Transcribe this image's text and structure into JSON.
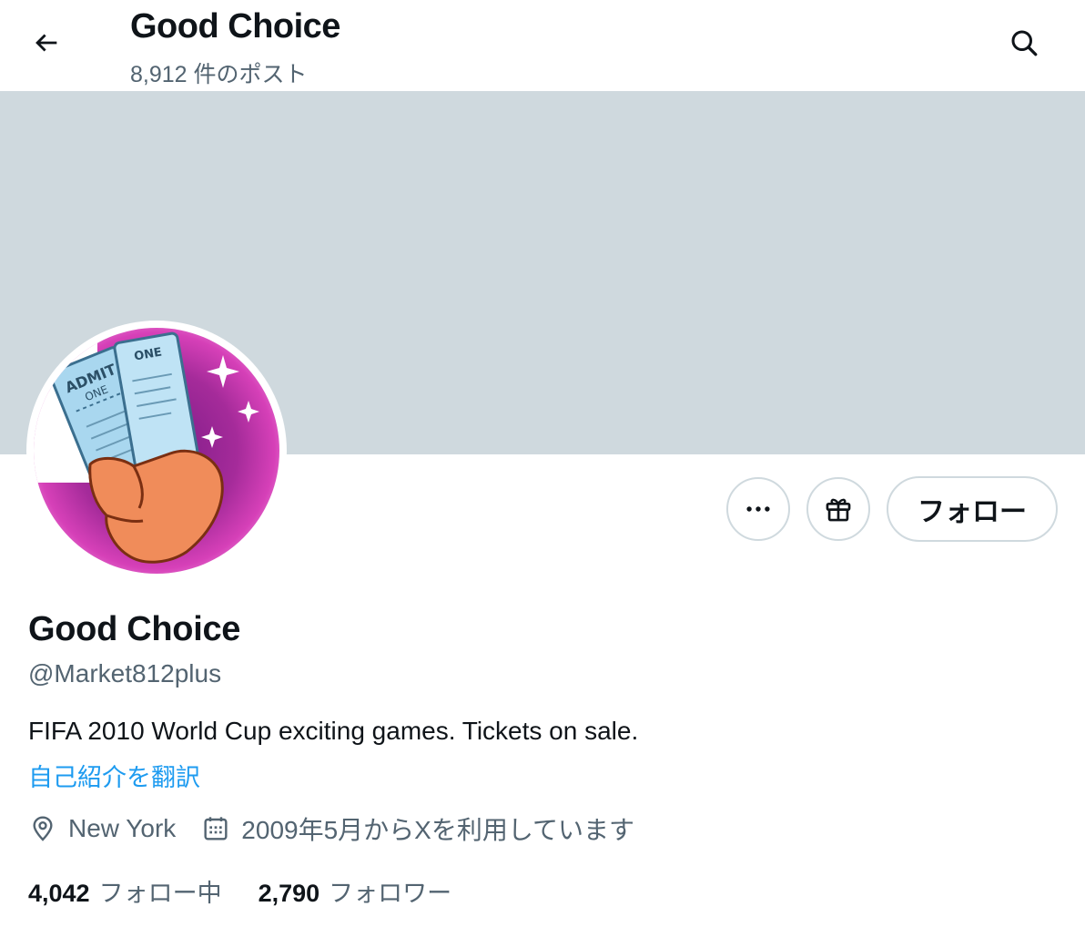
{
  "header": {
    "title": "Good Choice",
    "post_count": "8,912 件のポスト",
    "back_icon": "arrow-left-icon",
    "search_icon": "search-icon"
  },
  "banner": {
    "color": "#cfd9de"
  },
  "avatar": {
    "ticket_text_1": "ADMIT",
    "ticket_text_2": "ONE",
    "ticket_text_3": "ONE"
  },
  "actions": {
    "more_icon": "more-horizontal-icon",
    "gift_icon": "gift-icon",
    "follow_label": "フォロー"
  },
  "profile": {
    "display_name": "Good Choice",
    "handle": "@Market812plus",
    "bio": "FIFA 2010 World Cup exciting games. Tickets on sale.",
    "translate_label": "自己紹介を翻訳",
    "location": "New York",
    "joined": "2009年5月からXを利用しています"
  },
  "stats": {
    "following_count": "4,042",
    "following_label": "フォロー中",
    "followers_count": "2,790",
    "followers_label": "フォロワー"
  },
  "colors": {
    "text_primary": "#0f1419",
    "text_secondary": "#536471",
    "link": "#1d9bf0",
    "border": "#cfd9de"
  }
}
